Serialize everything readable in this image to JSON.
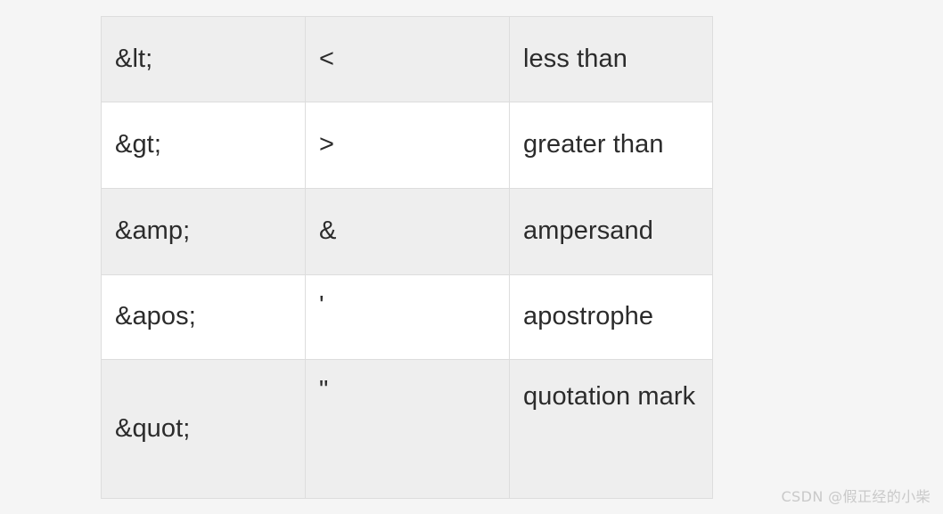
{
  "page": {
    "background_color": "#f5f5f5"
  },
  "table": {
    "name": "html-entity-reference-table",
    "border_color": "#dddddd",
    "shaded_row_color": "#eeeeee",
    "plain_row_color": "#ffffff",
    "text_color": "#2b2b2b",
    "columns": [
      "entity_code",
      "character",
      "description"
    ],
    "rows": [
      {
        "code": "&lt;",
        "char": "<",
        "desc": "less than",
        "shaded": true,
        "wrap": false
      },
      {
        "code": "&gt;",
        "char": ">",
        "desc": "greater than",
        "shaded": false,
        "wrap": false
      },
      {
        "code": "&amp;",
        "char": "&",
        "desc": "ampersand",
        "shaded": true,
        "wrap": false
      },
      {
        "code": "&apos;",
        "char": "'",
        "desc": "apostrophe",
        "shaded": false,
        "wrap": false
      },
      {
        "code": "&quot;",
        "char": "\"",
        "desc": "quotation mark",
        "shaded": true,
        "wrap": true
      }
    ]
  },
  "watermark": {
    "text": "CSDN @假正经的小柴",
    "color": "#c9c9c9"
  }
}
